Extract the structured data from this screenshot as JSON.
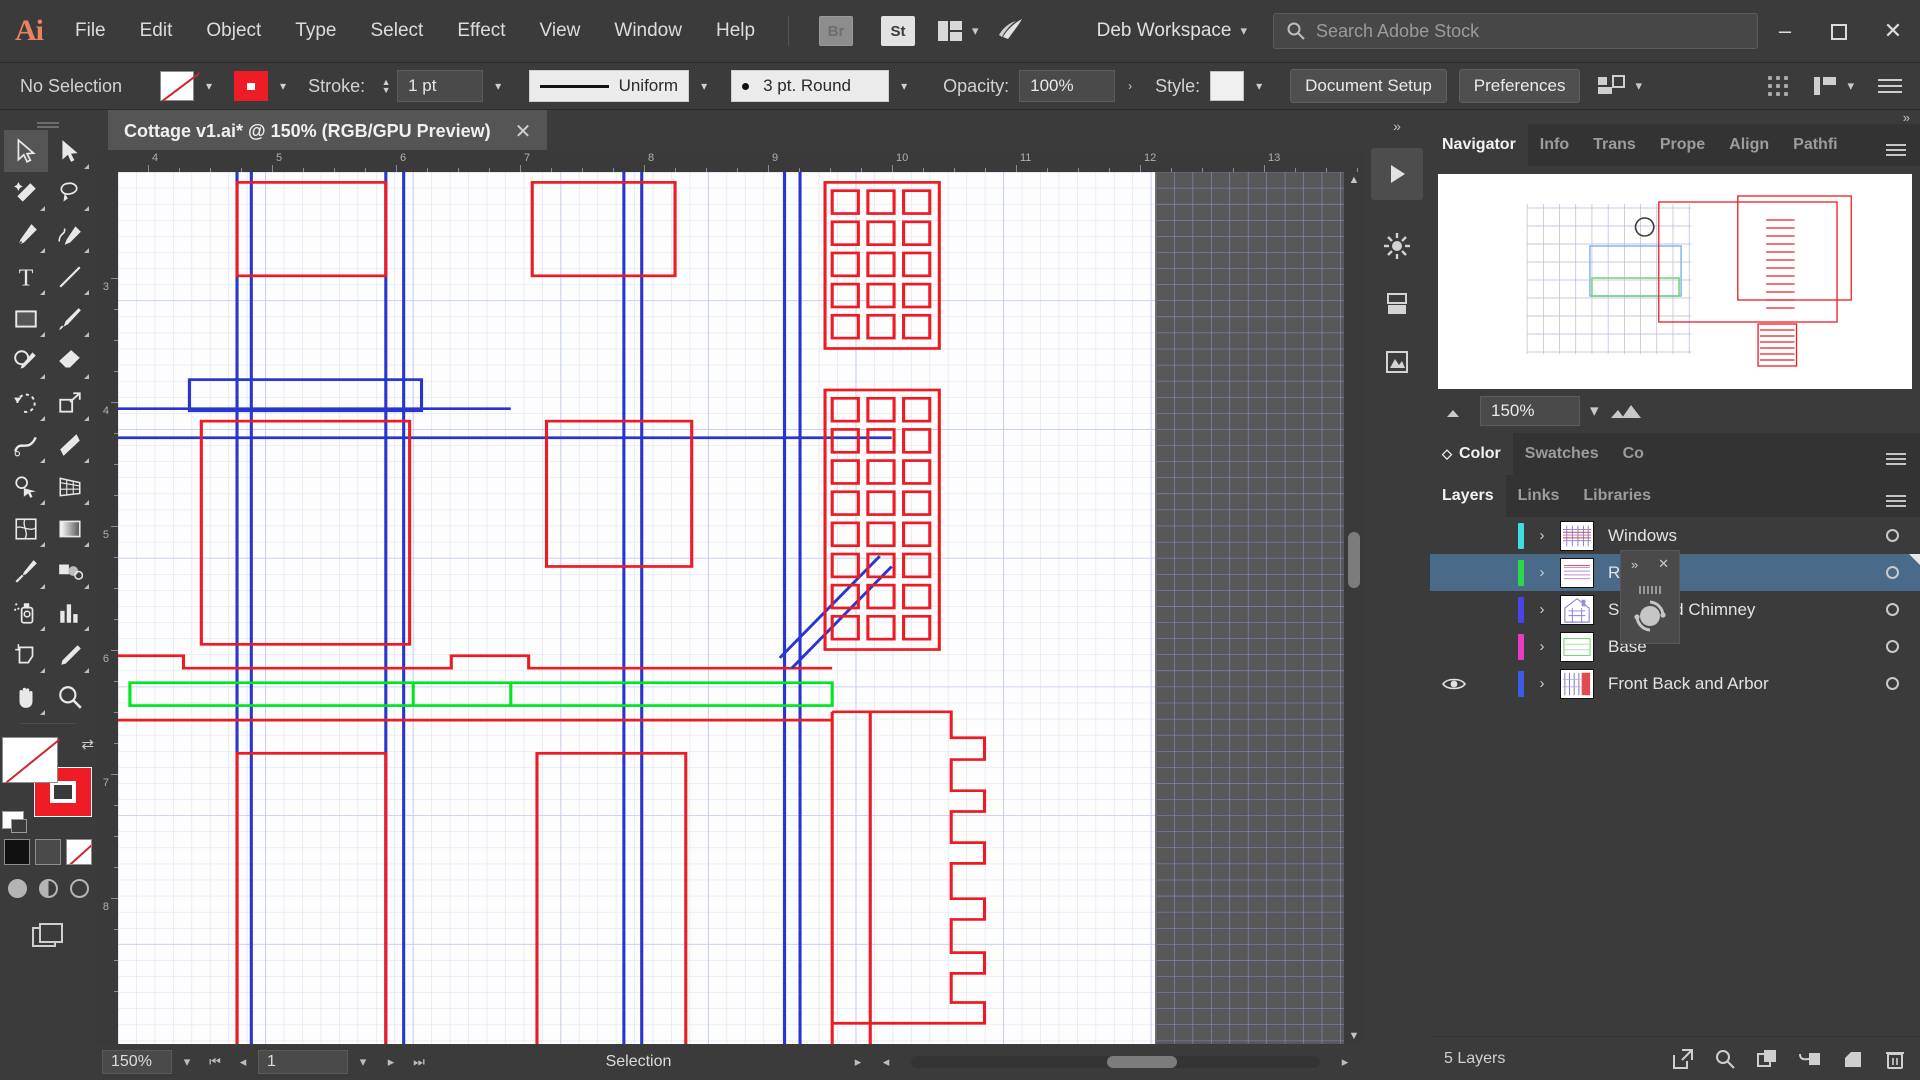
{
  "app": {
    "name": "Adobe Illustrator",
    "logo": "Ai"
  },
  "menubar": {
    "items": [
      "File",
      "Edit",
      "Object",
      "Type",
      "Select",
      "Effect",
      "View",
      "Window",
      "Help"
    ],
    "bridge_label": "Br",
    "stock_label": "St",
    "arrange_icon": "arrange-documents-icon",
    "chevron_icon": "chevron-down-icon",
    "rocket_icon": "discover-rocket-icon",
    "workspace": "Deb Workspace",
    "workspace_chevron": "chevron-down-icon",
    "search_icon": "search-icon",
    "search_placeholder": "Search Adobe Stock",
    "window_minimize": "–",
    "window_maximize": "❐",
    "window_close": "✕"
  },
  "controlbar": {
    "selection_status": "No Selection",
    "fill_swatch": "none-fill-swatch",
    "fill_chevron": "chevron-down-icon",
    "stroke_swatch": "red-stroke-swatch",
    "stroke_chevron": "chevron-down-icon",
    "stroke_label": "Stroke:",
    "stroke_weight": "1 pt",
    "stroke_weight_chevron": "chevron-down-icon",
    "variable_width_profile": "Uniform",
    "variable_width_chevron": "chevron-down-icon",
    "brush_definition": "3 pt. Round",
    "brush_chevron": "chevron-down-icon",
    "opacity_label": "Opacity:",
    "opacity_value": "100%",
    "opacity_more": "›",
    "style_label": "Style:",
    "style_chevron": "chevron-down-icon",
    "document_setup": "Document Setup",
    "preferences": "Preferences",
    "align_icon": "align-objects-icon",
    "align_chevron": "chevron-down-icon",
    "grip_icon": "grip-dots-icon",
    "arrange_icon": "arrange-panel-icon",
    "arrange_chevron": "chevron-down-icon",
    "menu_icon": "panel-menu-icon"
  },
  "toolbar": {
    "tools": [
      {
        "name": "selection-tool",
        "label": "Selection",
        "selected": true
      },
      {
        "name": "direct-selection-tool",
        "label": "Direct Selection",
        "selected": false
      },
      {
        "name": "magic-wand-tool",
        "label": "Magic Wand",
        "selected": false
      },
      {
        "name": "lasso-tool",
        "label": "Lasso",
        "selected": false
      },
      {
        "name": "pen-tool",
        "label": "Pen",
        "selected": false
      },
      {
        "name": "curvature-tool",
        "label": "Curvature",
        "selected": false
      },
      {
        "name": "type-tool",
        "label": "Type",
        "selected": false
      },
      {
        "name": "line-segment-tool",
        "label": "Line Segment",
        "selected": false
      },
      {
        "name": "rectangle-tool",
        "label": "Rectangle",
        "selected": false
      },
      {
        "name": "paintbrush-tool",
        "label": "Paintbrush",
        "selected": false
      },
      {
        "name": "shaper-tool",
        "label": "Shaper",
        "selected": false
      },
      {
        "name": "eraser-tool",
        "label": "Eraser",
        "selected": false
      },
      {
        "name": "rotate-tool",
        "label": "Rotate",
        "selected": false
      },
      {
        "name": "scale-tool",
        "label": "Scale",
        "selected": false
      },
      {
        "name": "width-tool",
        "label": "Width",
        "selected": false
      },
      {
        "name": "free-transform-tool",
        "label": "Free Transform",
        "selected": false
      },
      {
        "name": "shape-builder-tool",
        "label": "Shape Builder",
        "selected": false
      },
      {
        "name": "perspective-grid-tool",
        "label": "Perspective Grid",
        "selected": false
      },
      {
        "name": "mesh-tool",
        "label": "Mesh",
        "selected": false
      },
      {
        "name": "gradient-tool",
        "label": "Gradient",
        "selected": false
      },
      {
        "name": "eyedropper-tool",
        "label": "Eyedropper",
        "selected": false
      },
      {
        "name": "blend-tool",
        "label": "Blend",
        "selected": false
      },
      {
        "name": "symbol-sprayer-tool",
        "label": "Symbol Sprayer",
        "selected": false
      },
      {
        "name": "column-graph-tool",
        "label": "Column Graph",
        "selected": false
      },
      {
        "name": "artboard-tool",
        "label": "Artboard",
        "selected": false
      },
      {
        "name": "slice-tool",
        "label": "Slice",
        "selected": false
      },
      {
        "name": "hand-tool",
        "label": "Hand",
        "selected": false
      },
      {
        "name": "zoom-tool",
        "label": "Zoom",
        "selected": false
      }
    ],
    "fill_color": "#FFFFFF",
    "fill_state": "none",
    "stroke_color": "#EE1C25",
    "swap_icon": "swap-fill-stroke-icon",
    "color_modes": [
      "color-swatch",
      "gradient-swatch",
      "none-swatch"
    ],
    "draw_modes": [
      "draw-normal",
      "draw-behind",
      "draw-inside"
    ],
    "screen_mode_icon": "change-screen-mode-icon"
  },
  "document": {
    "tab_title": "Cottage v1.ai* @ 150% (RGB/GPU Preview)",
    "close_icon": "close-icon",
    "ruler_h_labels": [
      "4",
      "5",
      "6",
      "7",
      "8",
      "9",
      "10",
      "11",
      "12",
      "13"
    ],
    "ruler_v_labels": [
      "3",
      "4",
      "5",
      "6",
      "7",
      "8"
    ]
  },
  "statusbar": {
    "zoom": "150%",
    "zoom_chevron": "chevron-down-icon",
    "first_artboard": "first-artboard-icon",
    "prev_artboard": "previous-artboard-icon",
    "artboard_number": "1",
    "artboard_chevron": "chevron-down-icon",
    "next_artboard": "next-artboard-icon",
    "last_artboard": "last-artboard-icon",
    "status_text": "Selection",
    "status_arrow": "status-menu-arrow-icon",
    "scroll_left": "scroll-left-icon",
    "scroll_right": "scroll-right-icon"
  },
  "dockrail": {
    "collapse_icon": "expand-panels-icon",
    "items": [
      {
        "name": "rail-properties",
        "icon": "play-triangle-icon",
        "active": true,
        "label": ""
      },
      {
        "name": "rail-libraries",
        "icon": "asterisk-icon",
        "active": false,
        "label": "Libraries"
      },
      {
        "name": "rail-layers",
        "icon": "layers-icon",
        "active": false,
        "label": "Layers"
      },
      {
        "name": "rail-image-trace",
        "icon": "image-trace-icon",
        "active": false,
        "label": "Trace"
      }
    ]
  },
  "rightdock": {
    "collapse_icon": "collapse-panels-icon",
    "top_tabs": [
      {
        "label": "Navigator",
        "active": true
      },
      {
        "label": "Info",
        "active": false
      },
      {
        "label": "Trans",
        "active": false
      },
      {
        "label": "Prope",
        "active": false
      },
      {
        "label": "Align",
        "active": false
      },
      {
        "label": "Pathfi",
        "active": false
      }
    ],
    "top_tabs_menu": "panel-menu-icon",
    "navigator": {
      "zoom_out_icon": "zoom-out-mountain-icon",
      "zoom_value": "150%",
      "zoom_chevron": "chevron-down-icon",
      "zoom_in_icon": "zoom-in-mountain-icon"
    },
    "color_tabs": [
      {
        "label": "Color",
        "active": true
      },
      {
        "label": "Swatches",
        "active": false
      },
      {
        "label": "Co",
        "active": false
      }
    ],
    "color_tabs_menu": "panel-menu-icon",
    "float_panel": {
      "expand_icon": "»",
      "close_icon": "✕",
      "body_icon": "sync-circle-icon"
    },
    "layers_tabs": [
      {
        "label": "Layers",
        "active": true
      },
      {
        "label": "Links",
        "active": false
      },
      {
        "label": "Libraries",
        "active": false
      }
    ],
    "layers_tabs_menu": "panel-menu-icon",
    "layers": [
      {
        "name": "Windows",
        "color": "#3CE0E0",
        "visible": false,
        "selected": false,
        "expand_icon": "chevron-right-icon",
        "target_icon": "target-circle-icon"
      },
      {
        "name": "Roof",
        "color": "#2BD94A",
        "visible": false,
        "selected": true,
        "expand_icon": "chevron-right-icon",
        "target_icon": "target-circle-icon"
      },
      {
        "name": "Sides and Chimney",
        "color": "#4A44E8",
        "visible": false,
        "selected": false,
        "expand_icon": "chevron-right-icon",
        "target_icon": "target-circle-icon"
      },
      {
        "name": "Base",
        "color": "#E83CC0",
        "visible": false,
        "selected": false,
        "expand_icon": "chevron-right-icon",
        "target_icon": "target-circle-icon"
      },
      {
        "name": "Front Back and Arbor",
        "color": "#3C5CE8",
        "visible": true,
        "selected": false,
        "expand_icon": "chevron-right-icon",
        "target_icon": "target-circle-icon"
      }
    ],
    "layers_footer": {
      "count": "5 Layers",
      "icons": [
        "release-to-layers-icon",
        "locate-object-icon",
        "make-clipping-mask-icon",
        "create-new-sublayer-icon",
        "create-new-layer-icon",
        "delete-selection-icon"
      ]
    }
  },
  "colors": {
    "chrome": "#3b3b3b",
    "panel_dark": "#333333",
    "accent_selection": "#4a6a8a",
    "artwork_red": "#ED1C24",
    "artwork_blue": "#2A35D0",
    "artwork_green": "#00E522"
  }
}
